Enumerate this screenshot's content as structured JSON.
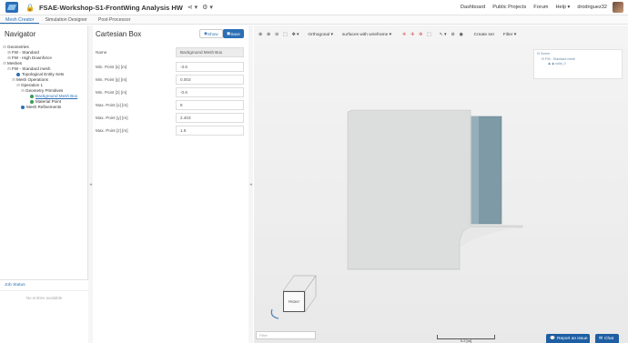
{
  "header": {
    "project_title": "FSAE-Workshop-S1-FrontWing Analysis HW",
    "nav": [
      "Dashboard",
      "Public Projects",
      "Forum",
      "Help ▾",
      "drodriguez32"
    ]
  },
  "tabs": [
    "Mesh Creator",
    "Simulation Designer",
    "Post-Processor"
  ],
  "navigator": {
    "title": "Navigator",
    "tree": [
      {
        "label": "Geometries",
        "toggle": "⊟",
        "level": 0
      },
      {
        "label": "FW - Standard",
        "toggle": "⊞",
        "level": 1
      },
      {
        "label": "FW - High Downforce",
        "toggle": "⊞",
        "level": 1
      },
      {
        "label": "Meshes",
        "toggle": "⊟",
        "level": 0
      },
      {
        "label": "FW - Standard mesh",
        "toggle": "⊟",
        "level": 1
      },
      {
        "label": "Topological Entity Sets",
        "toggle": "",
        "level": 2,
        "dot": "blue"
      },
      {
        "label": "Mesh Operations",
        "toggle": "⊟",
        "level": 2
      },
      {
        "label": "Operation 1",
        "toggle": "⊟",
        "level": 3
      },
      {
        "label": "Geometry Primitives",
        "toggle": "⊟",
        "level": 4
      },
      {
        "label": "Background Mesh Box",
        "toggle": "",
        "level": 5,
        "dot": "green",
        "selected": true
      },
      {
        "label": "Material Point",
        "toggle": "",
        "level": 5,
        "dot": "green"
      },
      {
        "label": "Mesh Refinements",
        "toggle": "",
        "level": 3,
        "dot": "blue"
      }
    ]
  },
  "jobs": {
    "title": "Job Status",
    "empty": "No entries available"
  },
  "panel": {
    "title": "Cartesian Box",
    "show_label": "Show",
    "save_label": "Save",
    "fields": [
      {
        "label": "Name",
        "value": "Background Mesh Box"
      },
      {
        "label": "Min. Point [x] [m]",
        "value": "-3.6"
      },
      {
        "label": "Min. Point [y] [m]",
        "value": "0.003"
      },
      {
        "label": "Min. Point [z] [m]",
        "value": "-0.6"
      },
      {
        "label": "Max. Point [x] [m]",
        "value": "8"
      },
      {
        "label": "Max. Point [y] [m]",
        "value": "2.403"
      },
      {
        "label": "Max. Point [z] [m]",
        "value": "1.8"
      }
    ]
  },
  "viewer": {
    "projection": "Orthogonal",
    "render_mode": "surfaces with wireframe",
    "create_set": "Create set",
    "filter": "Filter",
    "scene_tree": [
      "Scene",
      "FW - Standard mesh",
      "solid_0"
    ],
    "front_label": "FRONT",
    "filter_placeholder": "Filter",
    "scale_label": "0.2 [m]"
  },
  "footer": {
    "report_issue": "Report an issue",
    "chat": "Chat"
  },
  "colors": {
    "accent": "#2b6fb5",
    "body_fill": "#dcdedd",
    "cylinder": "#7e9aa6"
  }
}
